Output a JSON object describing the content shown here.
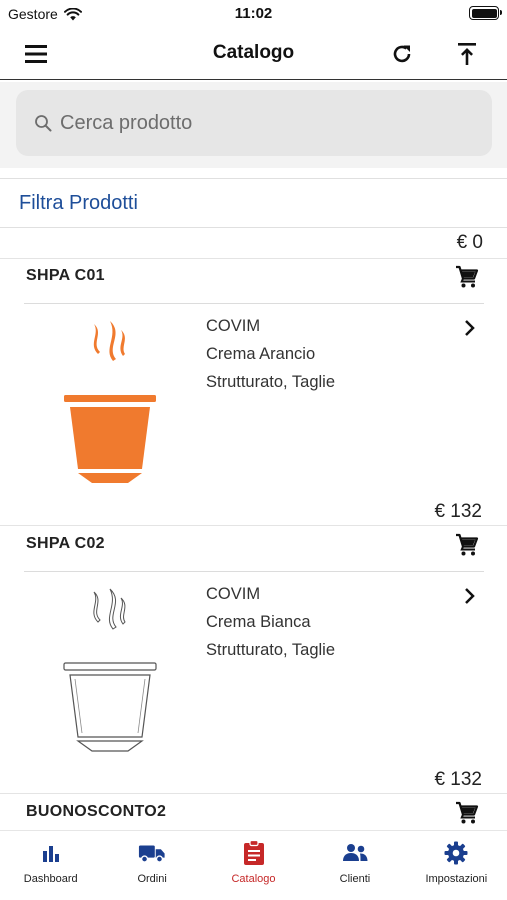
{
  "status_bar": {
    "carrier": "Gestore",
    "time": "11:02"
  },
  "nav": {
    "title": "Catalogo"
  },
  "search": {
    "placeholder": "Cerca prodotto"
  },
  "filter": {
    "label": "Filtra Prodotti"
  },
  "list": {
    "top_price": "€ 0",
    "products": [
      {
        "code": "SHPA C01",
        "brand": "COVIM",
        "name": "Crema Arancio",
        "attributes": "Strutturato, Taglie",
        "price": "€ 132",
        "image": "orange-coffee-capsule",
        "color": "#f07a2e"
      },
      {
        "code": "SHPA C02",
        "brand": "COVIM",
        "name": "Crema Bianca",
        "attributes": "Strutturato, Taglie",
        "price": "€ 132",
        "image": "white-coffee-capsule",
        "color": "#ffffff"
      },
      {
        "code": "BUONOSCONTO2"
      }
    ]
  },
  "tabs": [
    {
      "label": "Dashboard",
      "icon": "bar-chart-icon"
    },
    {
      "label": "Ordini",
      "icon": "truck-icon"
    },
    {
      "label": "Catalogo",
      "icon": "clipboard-icon",
      "active": true
    },
    {
      "label": "Clienti",
      "icon": "users-icon"
    },
    {
      "label": "Impostazioni",
      "icon": "gear-icon"
    }
  ],
  "colors": {
    "tab_icon": "#1b3f8f",
    "tab_active": "#c62828",
    "filter_text": "#1e4e99"
  }
}
